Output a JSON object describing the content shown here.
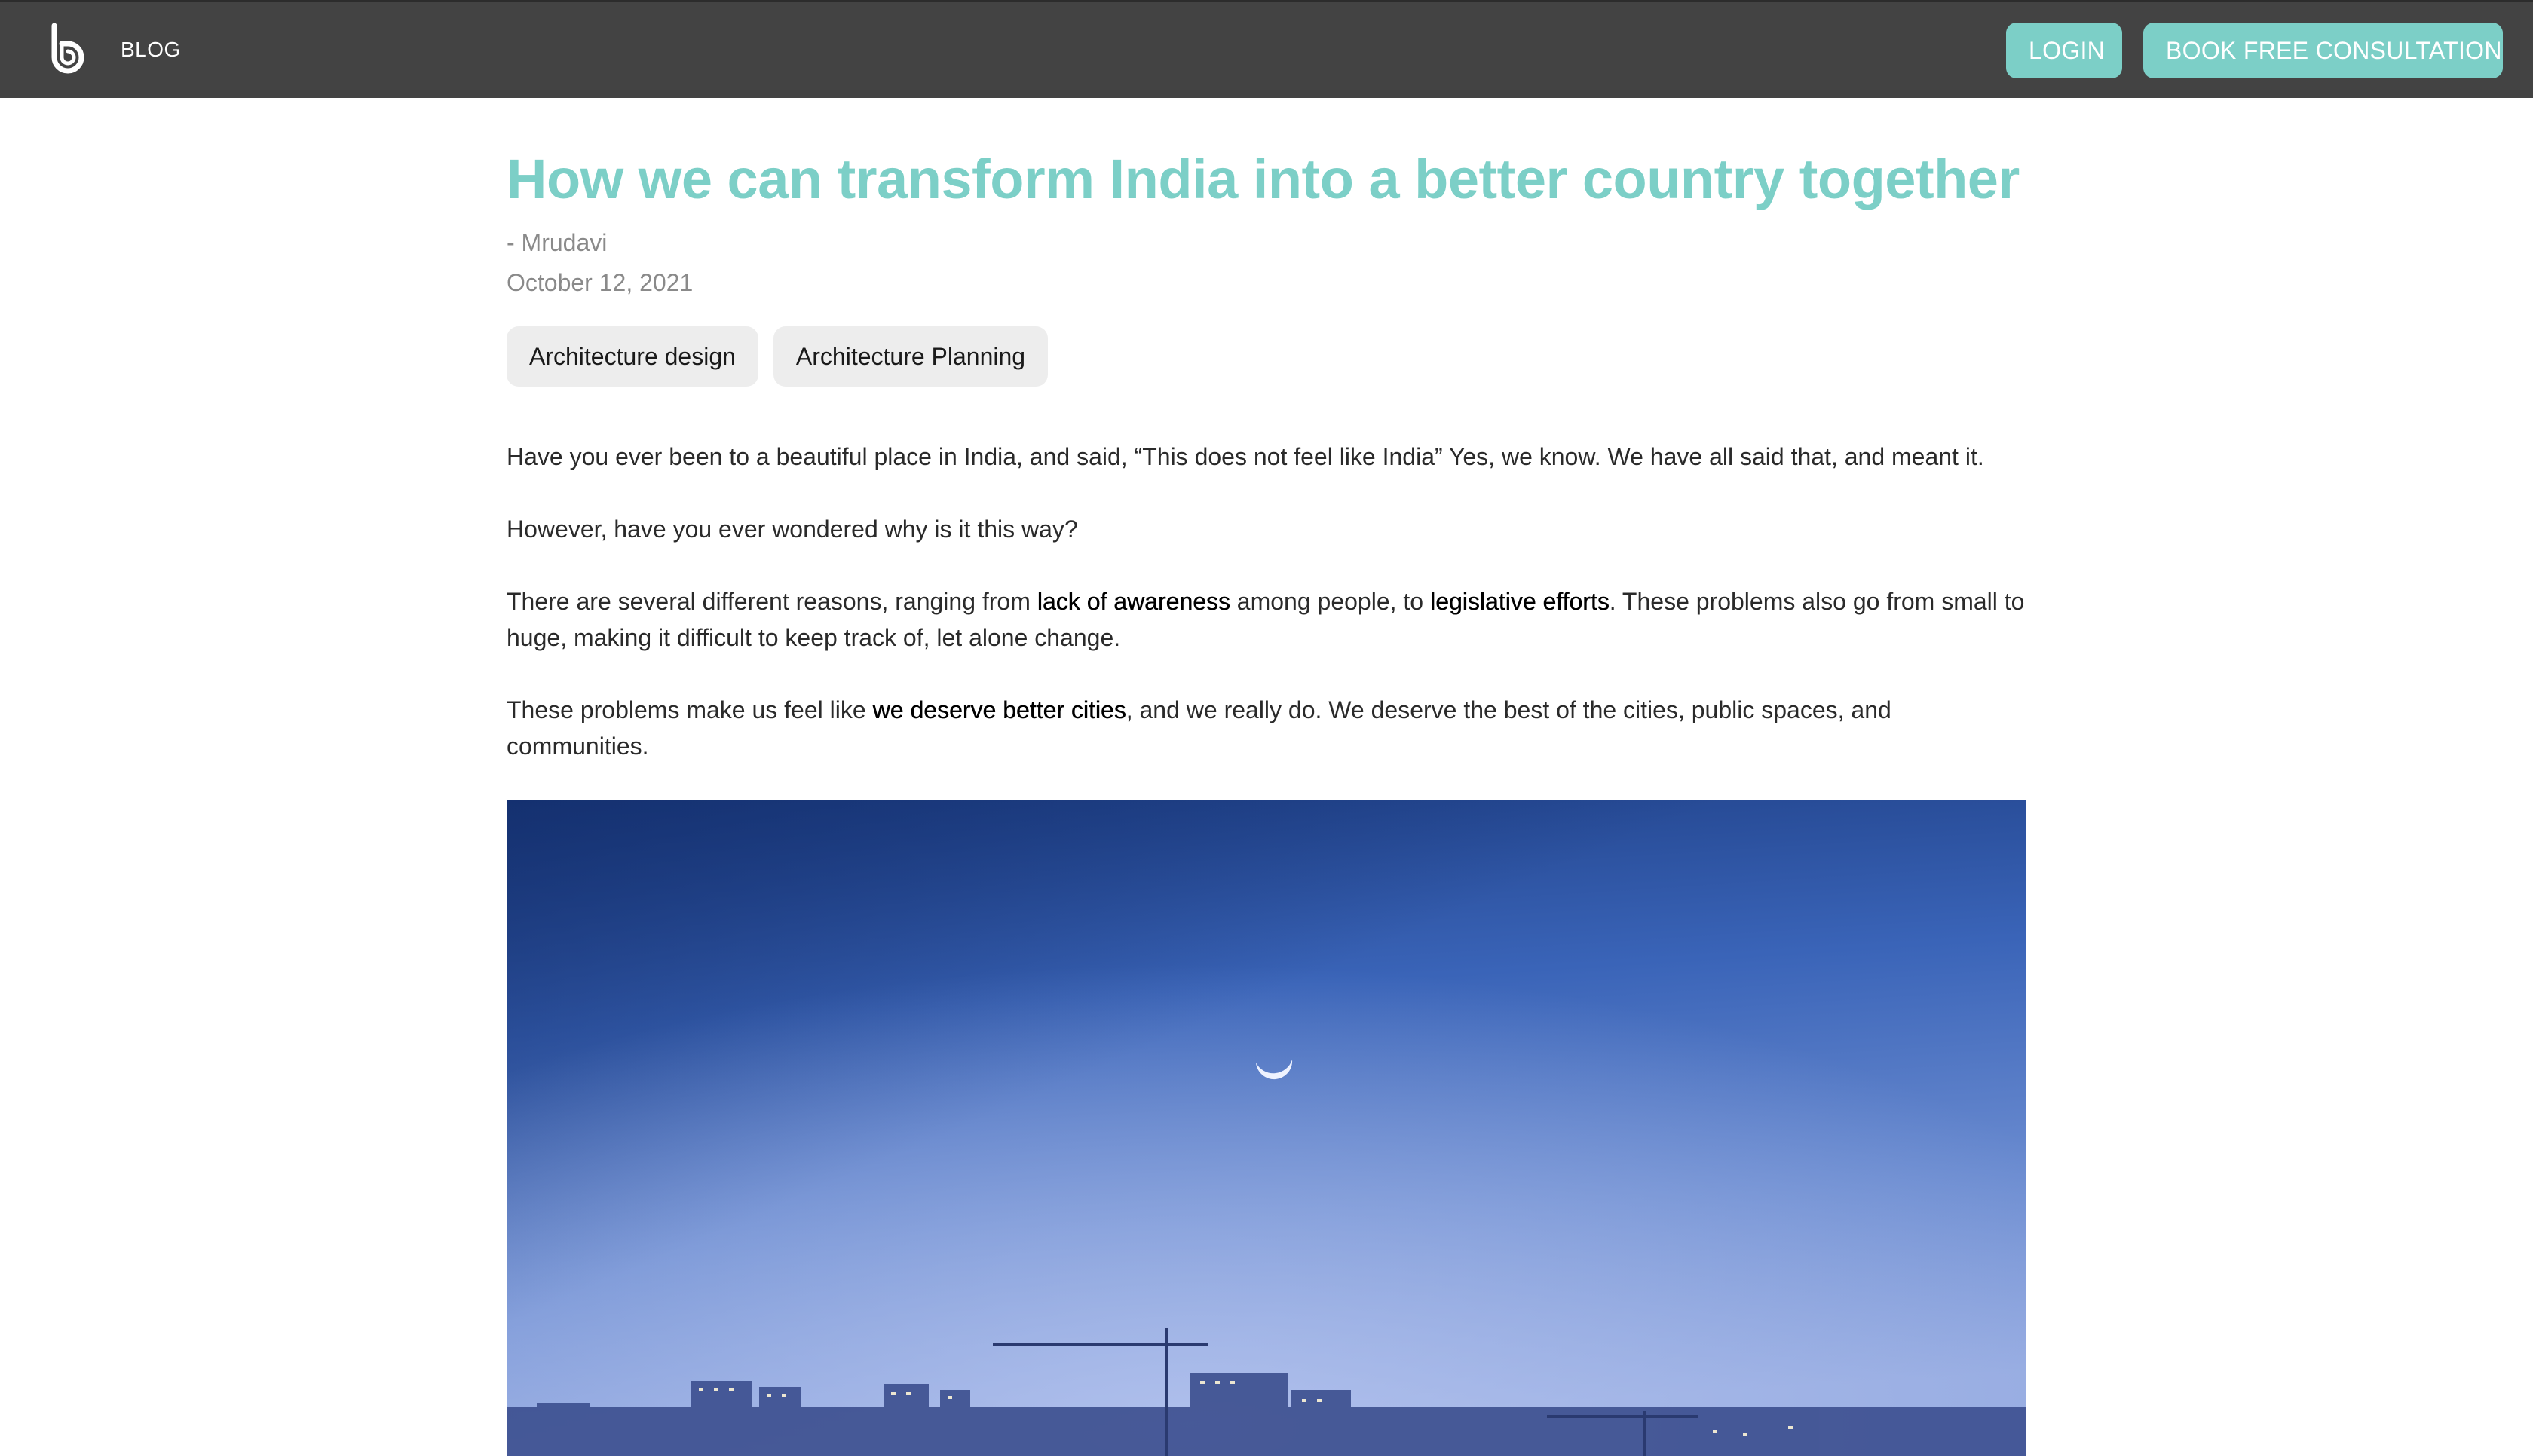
{
  "header": {
    "nav_blog": "BLOG",
    "login_label": "LOGIN",
    "consult_label": "BOOK FREE CONSULTATION",
    "logo_icon": "brand-logo-icon"
  },
  "colors": {
    "accent": "#7ccfc7",
    "header_bg": "#434343",
    "tag_bg": "#ededed",
    "meta_text": "#8a8a8a"
  },
  "article": {
    "title": "How we can transform India into a better country together",
    "author": "- Mrudavi",
    "date": "October 12, 2021",
    "tags": [
      "Architecture design",
      "Architecture Planning"
    ],
    "paragraphs": {
      "p1": "Have you ever been to a beautiful place in India, and said, “This does not feel like India” Yes, we know. We have all said that, and meant it.",
      "p2": "However, have you ever wondered why is it this way?",
      "p3": {
        "before": "There are several different reasons, ranging from ",
        "strong1": "lack of awareness",
        "middle": " among people, to ",
        "strong2": "legislative efforts",
        "after": ". These problems also go from small to huge, making it difficult to keep track of, let alone change."
      },
      "p4": {
        "before": "These problems make us feel like ",
        "strong": "we deserve better cities",
        "after": ", and we really do. We deserve the best of the cities, public spaces, and communities."
      }
    },
    "hero_image": "city-skyline-at-dusk-with-crescent-moon-image"
  }
}
